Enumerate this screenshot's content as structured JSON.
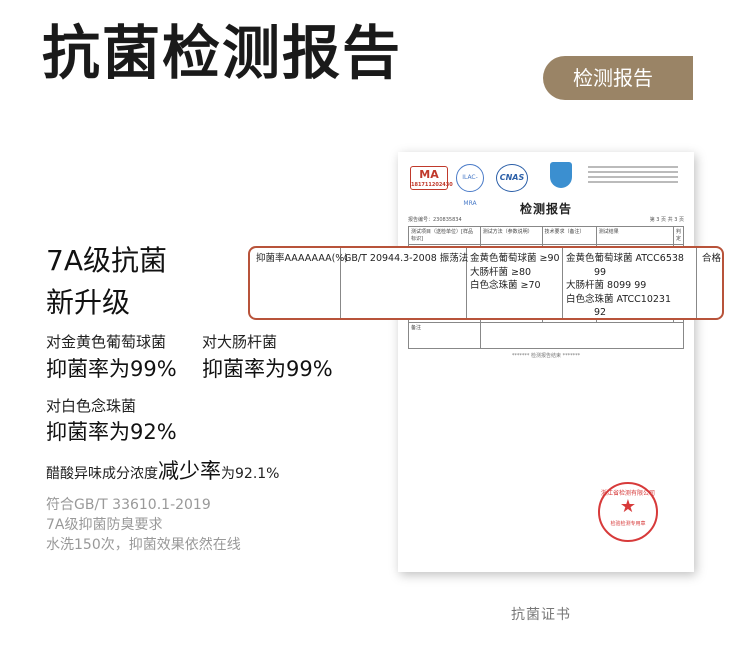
{
  "header": {
    "title": "抗菌检测报告",
    "badge": "检测报告"
  },
  "headline": {
    "line1": "7A级抗菌",
    "line2": "新升级"
  },
  "claims": [
    {
      "target": "对金黄色葡萄球菌",
      "result": "抑菌率为99%"
    },
    {
      "target": "对大肠杆菌",
      "result": "抑菌率为99%"
    },
    {
      "target": "对白色念珠菌",
      "result": "抑菌率为92%"
    }
  ],
  "odor": {
    "prefix": "醋酸异味成分浓度",
    "emphasis": "减少率",
    "suffix": "为92.1%"
  },
  "notes": [
    "符合GB/T 33610.1-2019",
    "7A级抑菌防臭要求",
    "水洗150次，抑菌效果依然在线"
  ],
  "document": {
    "logos": {
      "ma": "MA",
      "ma_code": "181711202430",
      "ilac": "ILAC-MRA",
      "cnas": "CNAS"
    },
    "title": "检测报告",
    "report_no": "报告编号：230835834",
    "page": "第 3 页 共 3 页",
    "headers": [
      "测试项目（送检单位）[样品标识]",
      "测试方法（参数说明）",
      "技术要求（备注）",
      "测试结果",
      "判定"
    ],
    "remark_label": "备注",
    "end_marker": "******* 检测报告结束 *******",
    "stamp": {
      "ring": "浙江省检测有限公司",
      "bottom": "检验检测专用章"
    }
  },
  "highlight": {
    "item": "抑菌率AAAAAAA(%)",
    "method": "GB/T 20944.3-2008 振荡法",
    "requirements": [
      "金黄色葡萄球菌 ≥90",
      "大肠杆菌 ≥80",
      "白色念珠菌 ≥70"
    ],
    "results": [
      "金黄色葡萄球菌 ATCC6538",
      "99",
      "大肠杆菌 8099   99",
      "白色念珠菌 ATCC10231",
      "92"
    ],
    "verdict": "合格"
  },
  "caption": "抗菌证书"
}
